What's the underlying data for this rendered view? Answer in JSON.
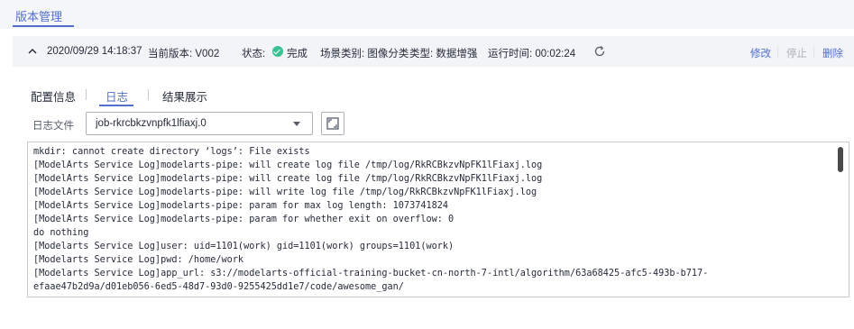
{
  "page_tabs": {
    "active_label": "版本管理"
  },
  "version": {
    "datetime": "2020/09/29 14:18:37",
    "current_version": "当前版本: V002",
    "status_label": "状态:",
    "status_value": "完成",
    "scene_category": "场景类别: 图像分类",
    "type": "类型: 数据增强",
    "runtime": "运行时间: 00:02:24",
    "actions": {
      "modify": "修改",
      "stop": "停止",
      "delete": "删除"
    }
  },
  "sub_tabs": [
    {
      "label": "配置信息"
    },
    {
      "label": "日志"
    },
    {
      "label": "结果展示"
    }
  ],
  "log_file": {
    "label": "日志文件",
    "selected": "job-rkrcbkzvnpfk1lfiaxj.0"
  },
  "log_lines": [
    "mkdir: cannot create directory ‘logs’: File exists",
    "[ModelArts Service Log]modelarts-pipe: will create log file /tmp/log/RkRCBkzvNpFK1lFiaxj.log",
    "[ModelArts Service Log]modelarts-pipe: will create log file /tmp/log/RkRCBkzvNpFK1lFiaxj.log",
    "[ModelArts Service Log]modelarts-pipe: will write log file /tmp/log/RkRCBkzvNpFK1lFiaxj.log",
    "[ModelArts Service Log]modelarts-pipe: param for max log length: 1073741824",
    "[ModelArts Service Log]modelarts-pipe: param for whether exit on overflow: 0",
    "do nothing",
    "[Modelarts Service Log]user: uid=1101(work) gid=1101(work) groups=1101(work)",
    "[Modelarts Service Log]pwd: /home/work",
    "[Modelarts Service Log]app_url: s3://modelarts-official-training-bucket-cn-north-7-intl/algorithm/63a68425-afc5-493b-b717-",
    "efaae47b2d9a/d01eb056-6ed5-48d7-93d0-9255425dd1e7/code/awesome_gan/"
  ],
  "icons": {
    "collapse": "chevron-up-icon",
    "status": "check-circle-icon",
    "refresh": "refresh-icon",
    "dropdown": "caret-down-icon",
    "fullscreen": "fullscreen-icon"
  },
  "colors": {
    "accent": "#526ecc",
    "success": "#3ac295",
    "disabled": "#adb0b8"
  }
}
